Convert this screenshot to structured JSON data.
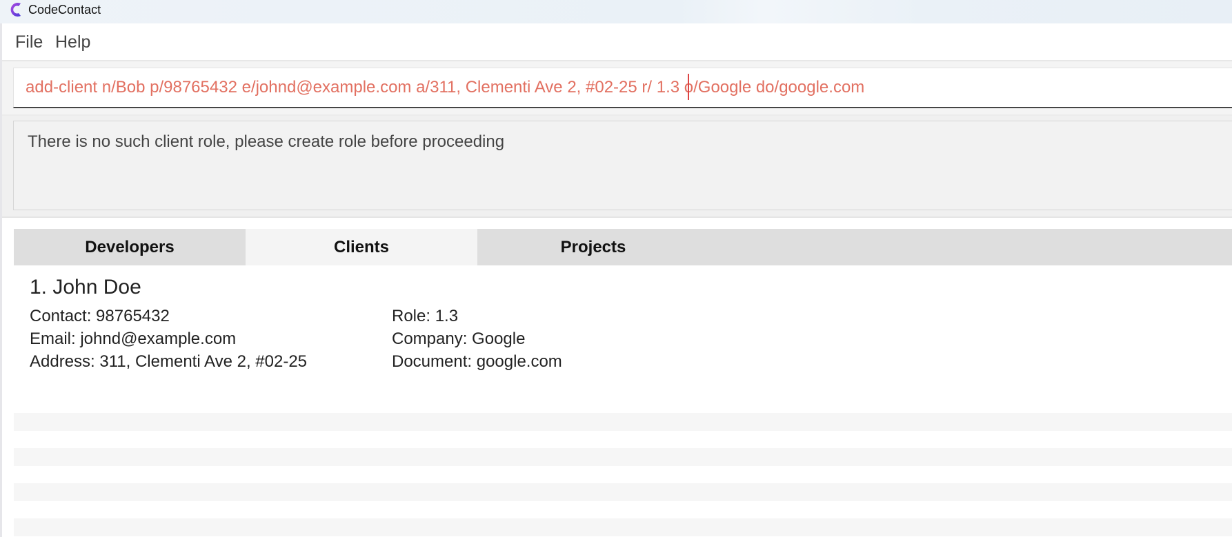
{
  "window": {
    "title": "CodeContact"
  },
  "menu": {
    "file": "File",
    "help": "Help"
  },
  "command": {
    "value": "add-client n/Bob p/98765432 e/johnd@example.com a/311, Clementi Ave 2, #02-25 r/ 1.3 o/Google do/google.com",
    "color": "#e27061"
  },
  "result": {
    "message": "There is no such client role, please create role before proceeding"
  },
  "tabs": [
    {
      "label": "Developers",
      "active": false
    },
    {
      "label": "Clients",
      "active": true
    },
    {
      "label": "Projects",
      "active": false
    }
  ],
  "clients": [
    {
      "title": "1.  John Doe",
      "contact": "Contact: 98765432",
      "email": "Email: johnd@example.com",
      "address": "Address: 311, Clementi Ave 2, #02-25",
      "role": "Role: 1.3",
      "company": "Company: Google",
      "document": "Document: google.com"
    }
  ],
  "colors": {
    "accent_icon": "#7b3fe4",
    "tab_active": "#f4f4f4",
    "tab_inactive": "#dedede"
  }
}
